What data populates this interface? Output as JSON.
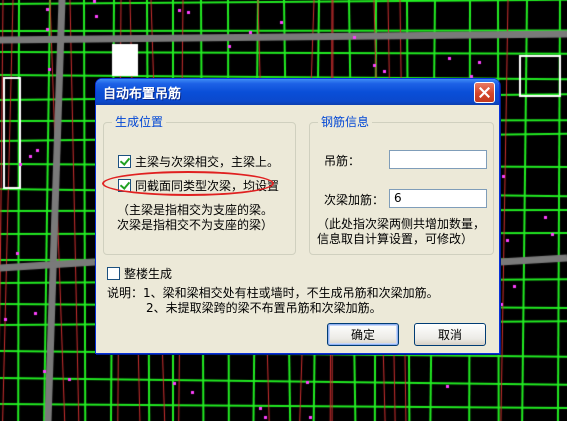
{
  "dialog": {
    "title": "自动布置吊筋",
    "close_label": "×",
    "position_group": {
      "title": "生成位置",
      "options": [
        {
          "label": "主梁与次梁相交，主梁上。",
          "checked": true
        },
        {
          "label": "同截面同类型次梁，均设置",
          "checked": true
        }
      ],
      "note_line1": "（主梁是指相交为支座的梁。",
      "note_line2": "次梁是指相交不为支座的梁）"
    },
    "rebar_group": {
      "title": "钢筋信息",
      "hanger_label": "吊筋：",
      "hanger_value": "",
      "secondary_label": "次梁加筋：",
      "secondary_value": "6",
      "note_line1": "（此处指次梁两侧共增加数量，",
      "note_line2": "信息取自计算设置，可修改）"
    },
    "whole_building": {
      "label": "整楼生成",
      "checked": false
    },
    "explanation": {
      "line1": "说明：1、梁和梁相交处有柱或墙时，不生成吊筋和次梁加筋。",
      "line2": "2、未提取梁跨的梁不布置吊筋和次梁加筋。"
    },
    "ok_label": "确定",
    "cancel_label": "取消"
  },
  "colors": {
    "title_bar": "#0a4fd8",
    "dialog_bg": "#ece9d8",
    "group_title": "#0046d5",
    "annotation": "#e02020",
    "cad_green": "#22ee22",
    "cad_background": "#000000"
  }
}
